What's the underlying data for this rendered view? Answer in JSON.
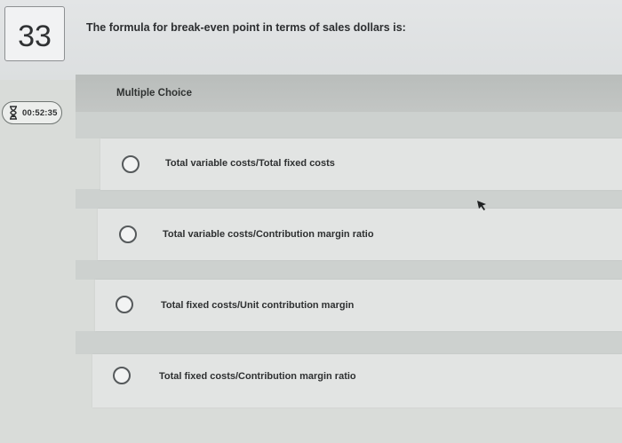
{
  "question": {
    "number": "33",
    "text": "The formula for break-even point in terms of sales dollars is:"
  },
  "timer": {
    "value": "00:52:35",
    "icon": "hourglass-icon"
  },
  "question_type": "Multiple Choice",
  "options": [
    {
      "label": "Total variable costs/Total fixed costs"
    },
    {
      "label": "Total variable costs/Contribution margin ratio"
    },
    {
      "label": "Total fixed costs/Unit contribution margin"
    },
    {
      "label": "Total fixed costs/Contribution margin ratio"
    }
  ],
  "colors": {
    "background": "#d9dcd9",
    "option_background": "#e2e4e3",
    "header_band": "#b9bdbb"
  }
}
